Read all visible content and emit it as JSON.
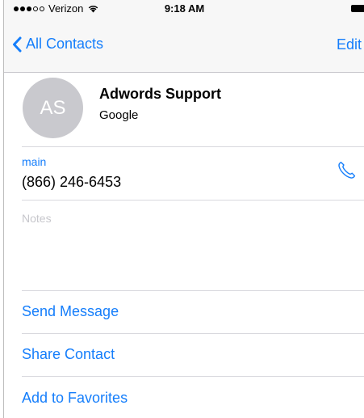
{
  "status_bar": {
    "carrier": "Verizon",
    "time": "9:18 AM"
  },
  "nav": {
    "back_label": "All Contacts",
    "edit_label": "Edit"
  },
  "contact": {
    "initials": "AS",
    "name": "Adwords Support",
    "company": "Google"
  },
  "phone": {
    "label": "main",
    "number": "(866) 246-6453"
  },
  "notes": {
    "label": "Notes"
  },
  "actions": {
    "send_message": "Send Message",
    "share_contact": "Share Contact",
    "add_to_favorites": "Add to Favorites"
  },
  "colors": {
    "accent": "#157efb",
    "avatar": "#c9c9ce",
    "separator": "#d9d9de",
    "placeholder": "#c7c7cc"
  }
}
